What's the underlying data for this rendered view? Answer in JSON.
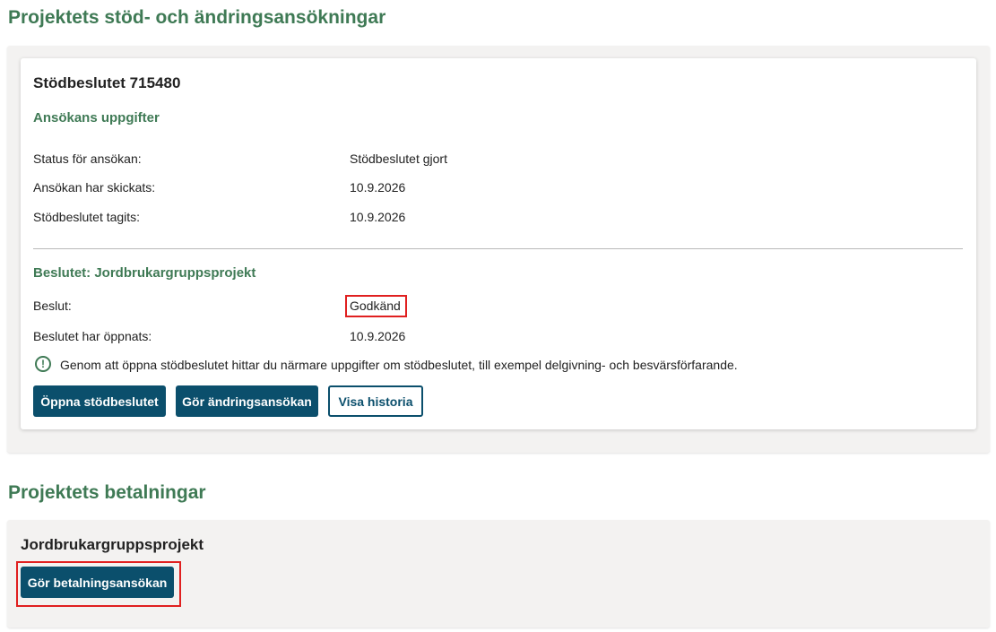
{
  "support_section": {
    "title": "Projektets stöd- och ändringsansökningar",
    "card": {
      "heading": "Stödbeslutet 715480",
      "application_details": {
        "subheading": "Ansökans uppgifter",
        "rows": [
          {
            "label": "Status för ansökan:",
            "value": "Stödbeslutet gjort"
          },
          {
            "label": "Ansökan har skickats:",
            "value": "10.9.2026"
          },
          {
            "label": "Stödbeslutet tagits:",
            "value": "10.9.2026"
          }
        ]
      },
      "decision": {
        "subheading": "Beslutet: Jordbrukargruppsprojekt",
        "rows": [
          {
            "label": "Beslut:",
            "value": "Godkänd"
          },
          {
            "label": "Beslutet har öppnats:",
            "value": "10.9.2026"
          }
        ],
        "info_icon": "info-circle-icon",
        "info_text": "Genom att öppna stödbeslutet hittar du närmare uppgifter om stödbeslutet, till exempel delgivning- och besvärsförfarande."
      },
      "buttons": {
        "open_decision": "Öppna stödbeslutet",
        "change_application": "Gör ändringsansökan",
        "show_history": "Visa historia"
      }
    }
  },
  "payments_section": {
    "title": "Projektets betalningar",
    "project_name": "Jordbrukargruppsprojekt",
    "payment_button": "Gör betalningsansökan"
  },
  "colors": {
    "heading_green": "#3f7a55",
    "button_blue": "#0b4f6c",
    "panel_background": "#f3f2f1",
    "highlight_red": "#e02020"
  }
}
